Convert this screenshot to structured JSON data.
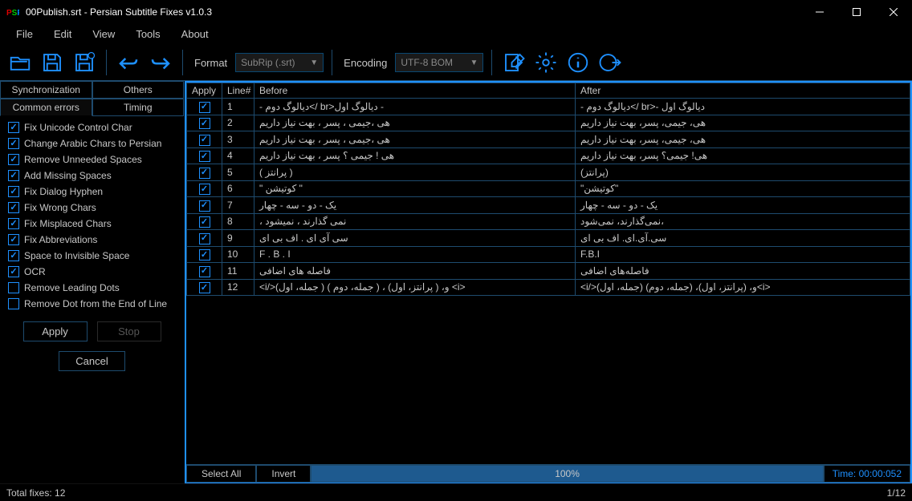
{
  "titlebar": {
    "title": "00Publish.srt - Persian Subtitle Fixes v1.0.3"
  },
  "menubar": [
    "File",
    "Edit",
    "View",
    "Tools",
    "About"
  ],
  "toolbar": {
    "format_label": "Format",
    "format_value": "SubRip (.srt)",
    "encoding_label": "Encoding",
    "encoding_value": "UTF-8 BOM"
  },
  "tabs": {
    "row1": [
      "Synchronization",
      "Others"
    ],
    "row2": [
      "Common errors",
      "Timing"
    ],
    "active": "Common errors"
  },
  "options": [
    {
      "label": "Fix Unicode Control Char",
      "checked": true
    },
    {
      "label": "Change Arabic Chars to Persian",
      "checked": true
    },
    {
      "label": "Remove Unneeded Spaces",
      "checked": true
    },
    {
      "label": "Add Missing Spaces",
      "checked": true
    },
    {
      "label": "Fix Dialog Hyphen",
      "checked": true
    },
    {
      "label": "Fix Wrong Chars",
      "checked": true
    },
    {
      "label": "Fix Misplaced Chars",
      "checked": true
    },
    {
      "label": "Fix Abbreviations",
      "checked": true
    },
    {
      "label": "Space to Invisible Space",
      "checked": true
    },
    {
      "label": "OCR",
      "checked": true
    },
    {
      "label": "Remove Leading Dots",
      "checked": false
    },
    {
      "label": "Remove Dot from the End of Line",
      "checked": false
    }
  ],
  "buttons": {
    "apply": "Apply",
    "stop": "Stop",
    "cancel": "Cancel"
  },
  "grid": {
    "headers": [
      "Apply",
      "Line#",
      "Before",
      "After"
    ],
    "rows": [
      {
        "apply": true,
        "line": "1",
        "before": "- دیالوگ دوم</ br>دیالوگ اول -",
        "after": "- دیالوگ دوم</ br>- دیالوگ اول"
      },
      {
        "apply": true,
        "line": "2",
        "before": "هی ،جیمی ، پسر ، بهت نیاز داریم",
        "after": "هی، جیمی، پسر، بهت نیاز داریم"
      },
      {
        "apply": true,
        "line": "3",
        "before": "هی ،جیمی ، پسر ، بهت نیاز داریم",
        "after": "هی، جیمی، پسر، بهت نیاز داریم"
      },
      {
        "apply": true,
        "line": "4",
        "before": "هی ! جیمی ؟ پسر ، بهت نیاز داریم",
        "after": "هی! جیمی؟ پسر، بهت نیاز داریم"
      },
      {
        "apply": true,
        "line": "5",
        "before": "( پرانتز )",
        "after": "(پرانتز)"
      },
      {
        "apply": true,
        "line": "6",
        "before": "\" کوتیشن \"",
        "after": "\"کوتیشن\""
      },
      {
        "apply": true,
        "line": "7",
        "before": "یک - دو  - سه  - چهار",
        "after": "یک - دو - سه - چهار"
      },
      {
        "apply": true,
        "line": "8",
        "before": "، نمی گذارند ، نمیشود",
        "after": "نمی‌گذارند، نمی‌شود،"
      },
      {
        "apply": true,
        "line": "9",
        "before": "سی آی ای . اف بی ای",
        "after": "سی.آی.ای. اف بی ای"
      },
      {
        "apply": true,
        "line": "10",
        "before": "F . B . I",
        "after": "F.B.I"
      },
      {
        "apply": true,
        "line": "11",
        "before": "فاصله های     اضافی",
        "after": "فاصله‌های اضافی"
      },
      {
        "apply": true,
        "line": "12",
        "before": "<i/>(جمله، اول ) و، ( پرانتز، اول) ، ( جمله، دوم ) <i>",
        "after": "<i/>(جمله، اول) و، (پرانتز، اول)، (جمله، دوم)<i>"
      }
    ]
  },
  "bottombar": {
    "select_all": "Select All",
    "invert": "Invert",
    "progress": "100%",
    "time_label": "Time:",
    "time_value": "00:00:052"
  },
  "statusbar": {
    "left": "Total fixes: 12",
    "right": "1/12"
  }
}
